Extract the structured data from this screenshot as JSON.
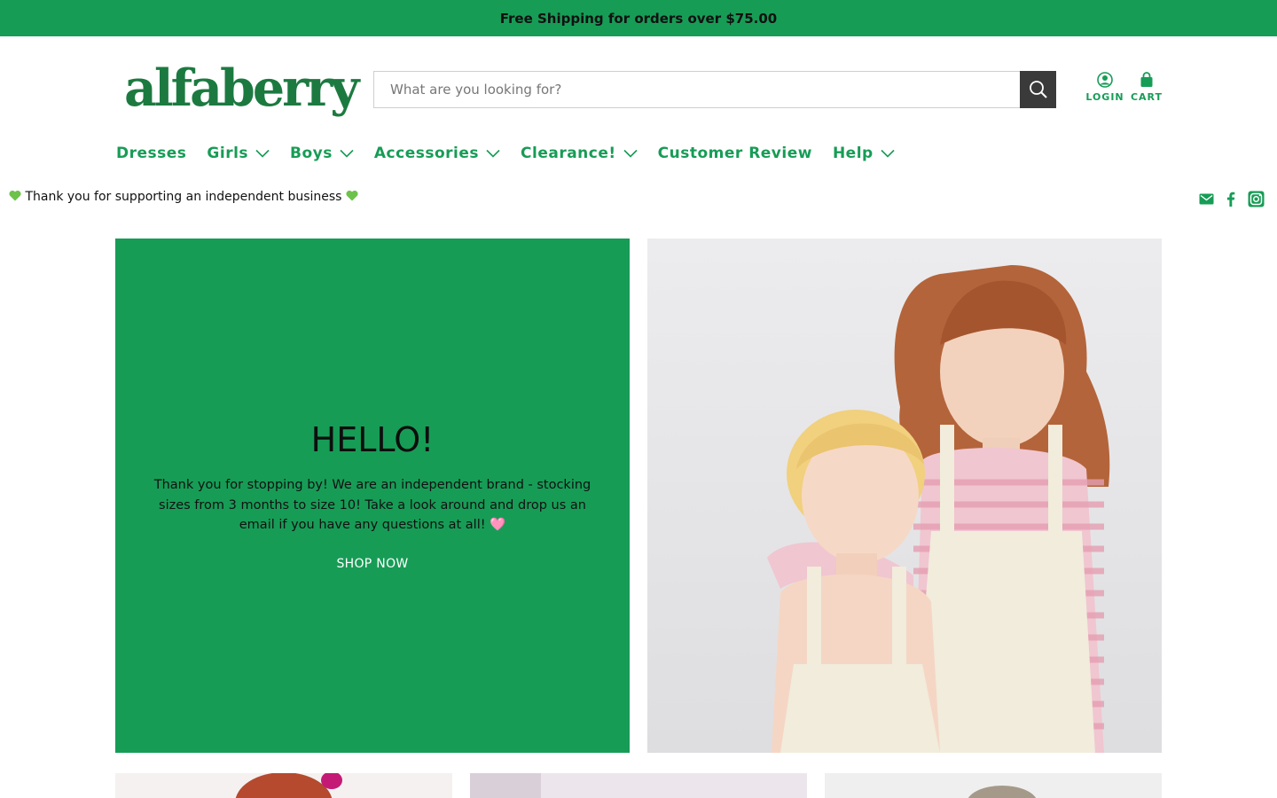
{
  "announcement": "Free Shipping for orders over $75.00",
  "brand": {
    "logo_text": "alfaberry",
    "color": "#1c7a40"
  },
  "search": {
    "placeholder": "What are you looking for?",
    "icon": "search-icon"
  },
  "account": {
    "login_label": "LOGIN",
    "cart_label": "CART"
  },
  "nav": [
    {
      "label": "Dresses",
      "has_menu": false
    },
    {
      "label": "Girls",
      "has_menu": true
    },
    {
      "label": "Boys",
      "has_menu": true
    },
    {
      "label": "Accessories",
      "has_menu": true
    },
    {
      "label": "Clearance!",
      "has_menu": true
    },
    {
      "label": "Customer Review",
      "has_menu": false
    },
    {
      "label": "Help",
      "has_menu": true
    }
  ],
  "tagline": "Thank you for supporting an independent business",
  "social": [
    "email-icon",
    "facebook-icon",
    "instagram-icon"
  ],
  "hero": {
    "title": "HELLO!",
    "text": "Thank you for stopping by! We are an independent brand - stocking sizes from 3 months to size 10! Take a look around and drop us an email if you have any questions at all! 🩷",
    "cta": "SHOP NOW"
  },
  "colors": {
    "accent": "#179c56",
    "dark": "#3a3a3a"
  }
}
